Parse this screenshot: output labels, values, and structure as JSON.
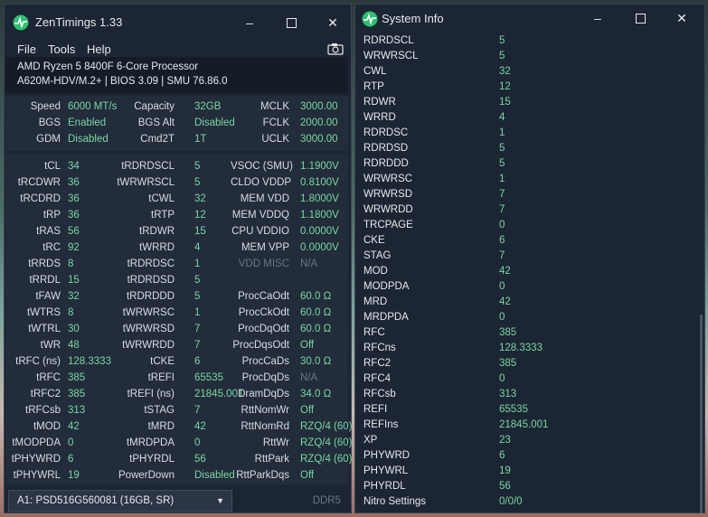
{
  "zt": {
    "title": "ZenTimings 1.33",
    "menu": [
      "File",
      "Tools",
      "Help"
    ],
    "cpu": "AMD Ryzen 5 8400F 6-Core Processor",
    "board": "A620M-HDV/M.2+ | BIOS 3.09 | SMU 76.86.0",
    "top_rows": [
      [
        "Speed",
        "6000 MT/s",
        "Capacity",
        "32GB",
        "MCLK",
        "3000.00"
      ],
      [
        "BGS",
        "Enabled",
        "BGS Alt",
        "Disabled",
        "FCLK",
        "2000.00"
      ],
      [
        "GDM",
        "Disabled",
        "Cmd2T",
        "1T",
        "UCLK",
        "3000.00"
      ]
    ],
    "timing_rows": [
      [
        "tCL",
        "34",
        "tRDRDSCL",
        "5",
        "VSOC (SMU)",
        "1.1900V"
      ],
      [
        "tRCDWR",
        "36",
        "tWRWRSCL",
        "5",
        "CLDO VDDP",
        "0.8100V"
      ],
      [
        "tRCDRD",
        "36",
        "tCWL",
        "32",
        "MEM VDD",
        "1.8000V"
      ],
      [
        "tRP",
        "36",
        "tRTP",
        "12",
        "MEM VDDQ",
        "1.1800V"
      ],
      [
        "tRAS",
        "56",
        "tRDWR",
        "15",
        "CPU VDDIO",
        "0.0000V"
      ],
      [
        "tRC",
        "92",
        "tWRRD",
        "4",
        "MEM VPP",
        "0.0000V"
      ],
      [
        "tRRDS",
        "8",
        "tRDRDSC",
        "1",
        "VDD MISC",
        "N/A"
      ],
      [
        "tRRDL",
        "15",
        "tRDRDSD",
        "5",
        "",
        ""
      ],
      [
        "tFAW",
        "32",
        "tRDRDDD",
        "5",
        "ProcCaOdt",
        "60.0 Ω"
      ],
      [
        "tWTRS",
        "8",
        "tWRWRSC",
        "1",
        "ProcCkOdt",
        "60.0 Ω"
      ],
      [
        "tWTRL",
        "30",
        "tWRWRSD",
        "7",
        "ProcDqOdt",
        "60.0 Ω"
      ],
      [
        "tWR",
        "48",
        "tWRWRDD",
        "7",
        "ProcDqsOdt",
        "Off"
      ],
      [
        "tRFC (ns)",
        "128.3333",
        "tCKE",
        "6",
        "ProcCaDs",
        "30.0 Ω"
      ],
      [
        "tRFC",
        "385",
        "tREFI",
        "65535",
        "ProcDqDs",
        "N/A"
      ],
      [
        "tRFC2",
        "385",
        "tREFI (ns)",
        "21845.001",
        "DramDqDs",
        "34.0 Ω"
      ],
      [
        "tRFCsb",
        "313",
        "tSTAG",
        "7",
        "RttNomWr",
        "Off"
      ],
      [
        "tMOD",
        "42",
        "tMRD",
        "42",
        "RttNomRd",
        "RZQ/4 (60)"
      ],
      [
        "tMODPDA",
        "0",
        "tMRDPDA",
        "0",
        "RttWr",
        "RZQ/4 (60)"
      ],
      [
        "tPHYWRD",
        "6",
        "tPHYRDL",
        "56",
        "RttPark",
        "RZQ/4 (60)"
      ],
      [
        "tPHYWRL",
        "19",
        "PowerDown",
        "Disabled",
        "RttParkDqs",
        "Off"
      ]
    ],
    "dimm": "A1: PSD516G560081 (16GB, SR)",
    "ddr": "DDR5"
  },
  "si": {
    "title": "System Info",
    "rows": [
      [
        "RDRDSCL",
        "5"
      ],
      [
        "WRWRSCL",
        "5"
      ],
      [
        "CWL",
        "32"
      ],
      [
        "RTP",
        "12"
      ],
      [
        "RDWR",
        "15"
      ],
      [
        "WRRD",
        "4"
      ],
      [
        "RDRDSC",
        "1"
      ],
      [
        "RDRDSD",
        "5"
      ],
      [
        "RDRDDD",
        "5"
      ],
      [
        "WRWRSC",
        "1"
      ],
      [
        "WRWRSD",
        "7"
      ],
      [
        "WRWRDD",
        "7"
      ],
      [
        "TRCPAGE",
        "0"
      ],
      [
        "CKE",
        "6"
      ],
      [
        "STAG",
        "7"
      ],
      [
        "MOD",
        "42"
      ],
      [
        "MODPDA",
        "0"
      ],
      [
        "MRD",
        "42"
      ],
      [
        "MRDPDA",
        "0"
      ],
      [
        "RFC",
        "385"
      ],
      [
        "RFCns",
        "128.3333"
      ],
      [
        "RFC2",
        "385"
      ],
      [
        "RFC4",
        "0"
      ],
      [
        "RFCsb",
        "313"
      ],
      [
        "REFI",
        "65535"
      ],
      [
        "REFIns",
        "21845.001"
      ],
      [
        "XP",
        "23"
      ],
      [
        "PHYWRD",
        "6"
      ],
      [
        "PHYWRL",
        "19"
      ],
      [
        "PHYRDL",
        "56"
      ],
      [
        "Nitro Settings",
        "0/0/0"
      ]
    ]
  },
  "colors": {
    "window_bg": "#1c2533",
    "value_green": "#79d6a1",
    "dim_gray": "#6c7583"
  },
  "icons": [
    "pulse-icon",
    "minimize-icon",
    "maximize-icon",
    "close-icon",
    "camera-icon",
    "chevron-down-icon"
  ]
}
